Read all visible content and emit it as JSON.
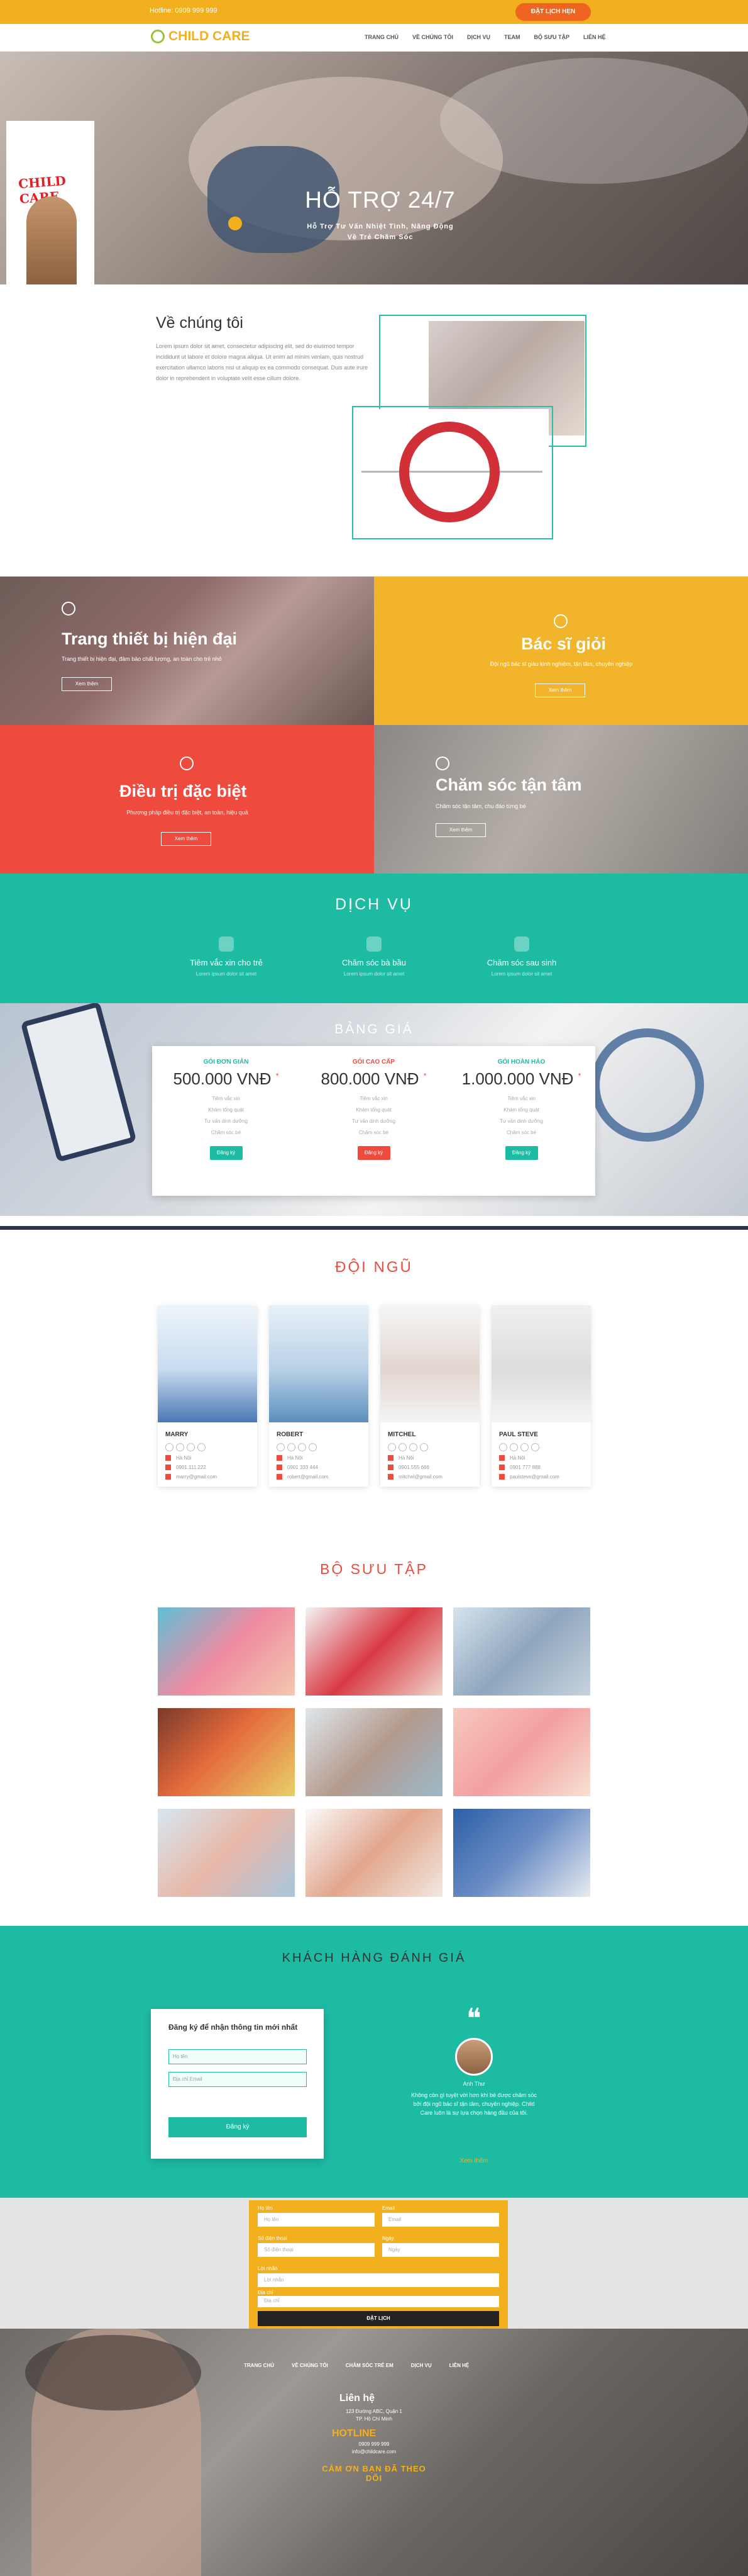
{
  "topbar": {
    "hotline": "Hotline: 0909 999 999",
    "cta": "ĐẶT LỊCH HẸN"
  },
  "nav": {
    "logo": "CHILD CARE",
    "items": [
      "TRANG CHỦ",
      "VỀ CHÚNG TÔI",
      "DỊCH VỤ",
      "TEAM",
      "BỘ SƯU TẬP",
      "LIÊN HỆ"
    ]
  },
  "hero": {
    "promo_title": "CHILD CARE",
    "title": "HỖ TRỢ 24/7",
    "subtitle": "Hỗ Trợ Tư Vấn Nhiệt Tình, Năng Động\nVề Trẻ Chăm Sóc"
  },
  "about": {
    "title": "Về chúng tôi",
    "text": "Lorem ipsum dolor sit amet, consectetur adipiscing elit, sed do eiusmod tempor incididunt ut labore et dolore magna aliqua. Ut enim ad minim veniam, quis nostrud exercitation ullamco laboris nisi ut aliquip ex ea commodo consequat. Duis aute irure dolor in reprehenderit in voluptate velit esse cillum dolore."
  },
  "features": [
    {
      "title": "Trang thiết bị hiện đại",
      "text": "Trang thiết bị hiện đại, đảm bảo chất lượng, an toàn cho trẻ nhỏ",
      "button": "Xem thêm"
    },
    {
      "title": "Bác sĩ giỏi",
      "text": "Đội ngũ bác sĩ giàu kinh nghiệm, tận tâm, chuyên nghiệp",
      "button": "Xem thêm"
    },
    {
      "title": "Điều trị đặc biệt",
      "text": "Phương pháp điều trị đặc biệt, an toàn, hiệu quả",
      "button": "Xem thêm"
    },
    {
      "title": "Chăm sóc tận tâm",
      "text": "Chăm sóc tận tâm, chu đáo từng bé",
      "button": "Xem thêm"
    }
  ],
  "services": {
    "title": "DỊCH VỤ",
    "items": [
      {
        "title": "Tiêm vắc xin cho trẻ",
        "desc": "Lorem ipsum dolor sit amet"
      },
      {
        "title": "Chăm sóc bà bầu",
        "desc": "Lorem ipsum dolor sit amet"
      },
      {
        "title": "Chăm sóc sau sinh",
        "desc": "Lorem ipsum dolor sit amet"
      }
    ]
  },
  "pricing": {
    "title": "BẢNG GIÁ",
    "plans": [
      {
        "name": "GÓI ĐƠN GIẢN",
        "price": "500.000 VNĐ",
        "features": [
          "Tiêm vắc xin",
          "Khám tổng quát",
          "Tư vấn dinh dưỡng",
          "Chăm sóc bé"
        ],
        "button": "Đăng ký",
        "color": "#1ebba3"
      },
      {
        "name": "GÓI CAO CẤP",
        "price": "800.000 VNĐ",
        "features": [
          "Tiêm vắc xin",
          "Khám tổng quát",
          "Tư vấn dinh dưỡng",
          "Chăm sóc bé"
        ],
        "button": "Đăng ký",
        "color": "#ef4a3e"
      },
      {
        "name": "GÓI HOÀN HẢO",
        "price": "1.000.000 VNĐ",
        "features": [
          "Tiêm vắc xin",
          "Khám tổng quát",
          "Tư vấn dinh dưỡng",
          "Chăm sóc bé"
        ],
        "button": "Đăng ký",
        "color": "#1ebba3"
      }
    ]
  },
  "team": {
    "title": "ĐỘI NGŨ",
    "members": [
      {
        "name": "MARRY",
        "address": "Hà Nội",
        "phone": "0901 111 222",
        "email": "marry@gmail.com"
      },
      {
        "name": "ROBERT",
        "address": "Hà Nội",
        "phone": "0901 333 444",
        "email": "robert@gmail.com"
      },
      {
        "name": "MITCHEL",
        "address": "Hà Nội",
        "phone": "0901 555 666",
        "email": "mitchel@gmail.com"
      },
      {
        "name": "PAUL STEVE",
        "address": "Hà Nội",
        "phone": "0901 777 888",
        "email": "paulsteve@gmail.com"
      }
    ]
  },
  "gallery": {
    "title": "BỘ SƯU TẬP"
  },
  "testimonials": {
    "title": "KHÁCH HÀNG ĐÁNH GIÁ",
    "form_title": "Đăng ký để nhận thông tin mới nhất",
    "name_placeholder": "Họ tên",
    "email_placeholder": "Địa chỉ Email",
    "submit": "Đăng ký",
    "reviewer": "Anh Thư",
    "review": "Không còn gì tuyệt vời hơn khi bé được chăm sóc bởi đội ngũ bác sĩ tận tâm, chuyên nghiệp. Child Care luôn là sự lựa chọn hàng đầu của tôi.",
    "more": "Xem thêm"
  },
  "booking": {
    "labels": [
      "Họ tên",
      "Email",
      "Số điện thoại",
      "Ngày",
      "Lời nhắn",
      "Địa chỉ"
    ],
    "placeholders": [
      "Họ tên",
      "Email",
      "Số điện thoại",
      "Ngày",
      "Lời nhắn",
      "Địa chỉ"
    ],
    "submit": "ĐẶT LỊCH"
  },
  "footer": {
    "items": [
      "TRANG CHỦ",
      "VỀ CHÚNG TÔI",
      "CHĂM SÓC TRẺ EM",
      "DỊCH VỤ",
      "LIÊN HỆ"
    ],
    "contact_title": "Liên hệ",
    "address": "123 Đường ABC, Quận 1\nTP. Hồ Chí Minh",
    "hotline_title": "HOTLINE",
    "hotline_text": "0909 999 999\ninfo@childcare.com",
    "thanks": "CẢM ƠN BẠN ĐÃ THEO DÕI"
  }
}
